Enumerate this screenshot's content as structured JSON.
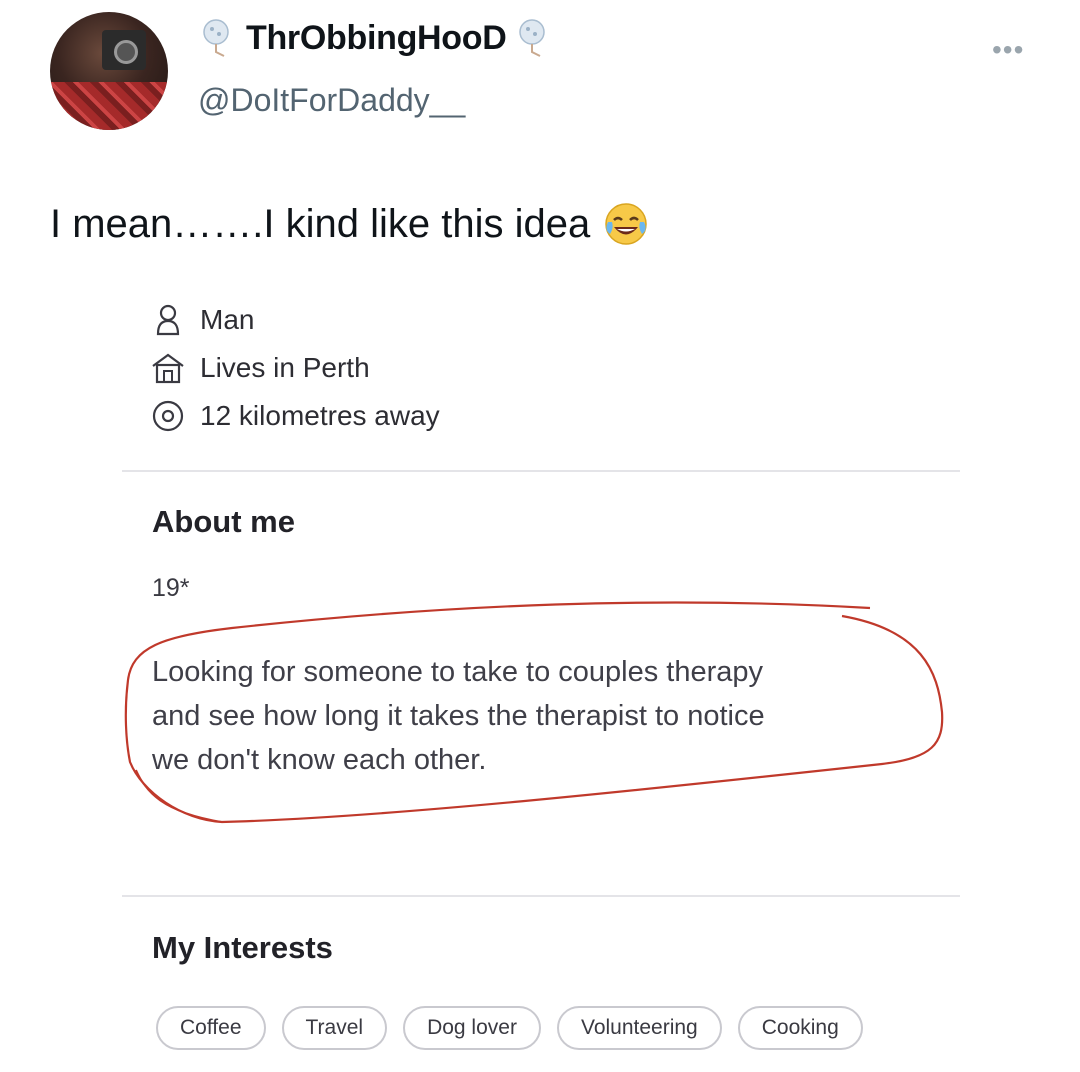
{
  "tweet": {
    "display_name": "ThrObbingHooD",
    "handle": "@DoItForDaddy__",
    "text": "I mean…….I kind like this idea",
    "emoji": "face-with-tears-of-joy-icon",
    "more_icon": "more-icon"
  },
  "profile": {
    "details": [
      {
        "icon": "person-icon",
        "label": "Man"
      },
      {
        "icon": "house-icon",
        "label": "Lives in Perth"
      },
      {
        "icon": "location-pin-icon",
        "label": "12 kilometres away"
      }
    ],
    "about_title": "About me",
    "age": "19*",
    "bio_lines": [
      "Looking for someone to take to couples therapy",
      "and see how  long it takes the therapist to notice",
      "we don't know each other."
    ],
    "interests_title": "My Interests",
    "interests": [
      "Coffee",
      "Travel",
      "Dog lover",
      "Volunteering",
      "Cooking"
    ]
  },
  "colors": {
    "annotation_circle": "#c0392b",
    "handle_gray": "#536471",
    "divider": "#e4e4e8"
  }
}
